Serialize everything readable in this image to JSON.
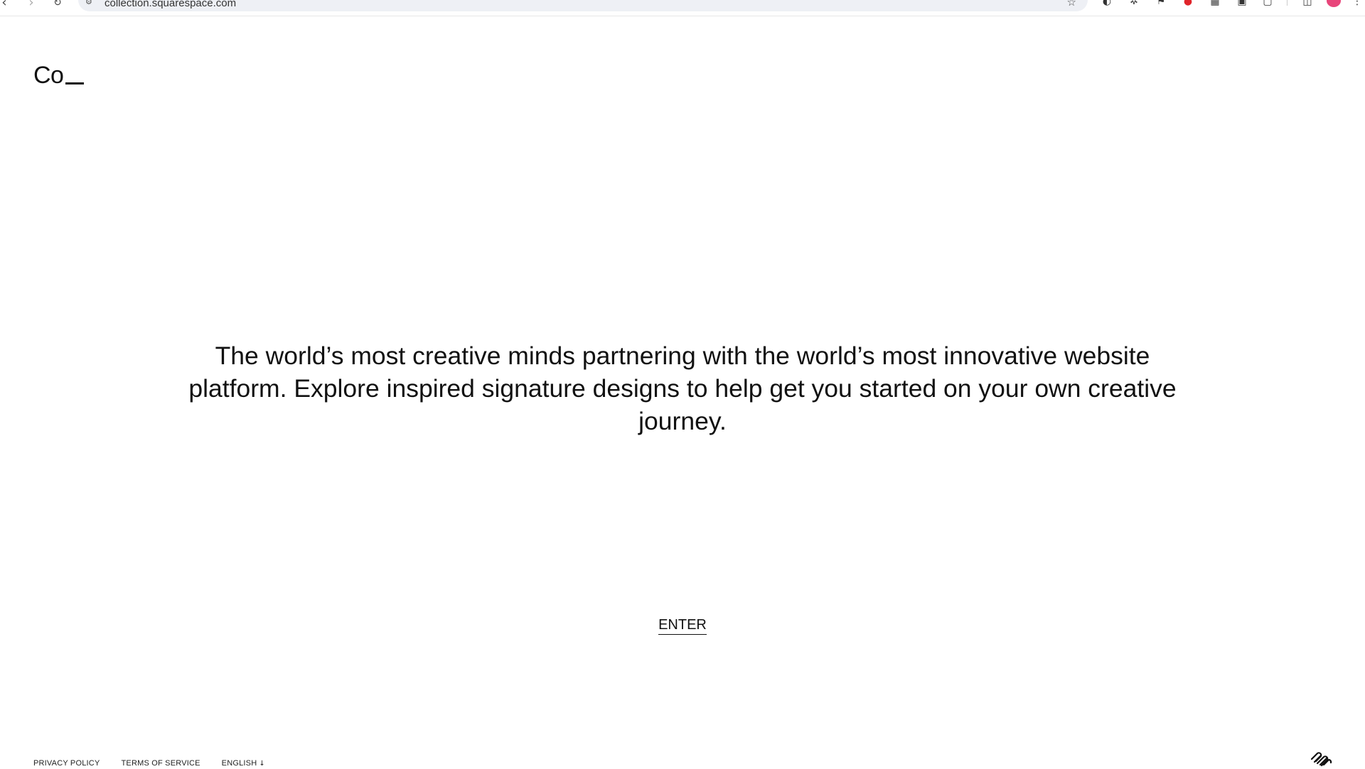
{
  "browser": {
    "url": "collection.squarespace.com",
    "nav": {
      "back_icon": "back-arrow-icon",
      "forward_icon": "forward-arrow-icon",
      "reload_icon": "reload-icon"
    }
  },
  "header": {
    "logo_text": "Co"
  },
  "hero": {
    "text": "The world’s most creative minds partnering with the world’s most innovative website platform. Explore inspired signature designs to help get you started on your own creative journey."
  },
  "cta": {
    "enter_label": "ENTER"
  },
  "footer": {
    "privacy_label": "PRIVACY POLICY",
    "terms_label": "TERMS OF SERVICE",
    "language_label": "ENGLISH"
  },
  "colors": {
    "text": "#111111",
    "background": "#ffffff",
    "omnibox": "#eef0f5",
    "avatar": "#e8457a"
  }
}
